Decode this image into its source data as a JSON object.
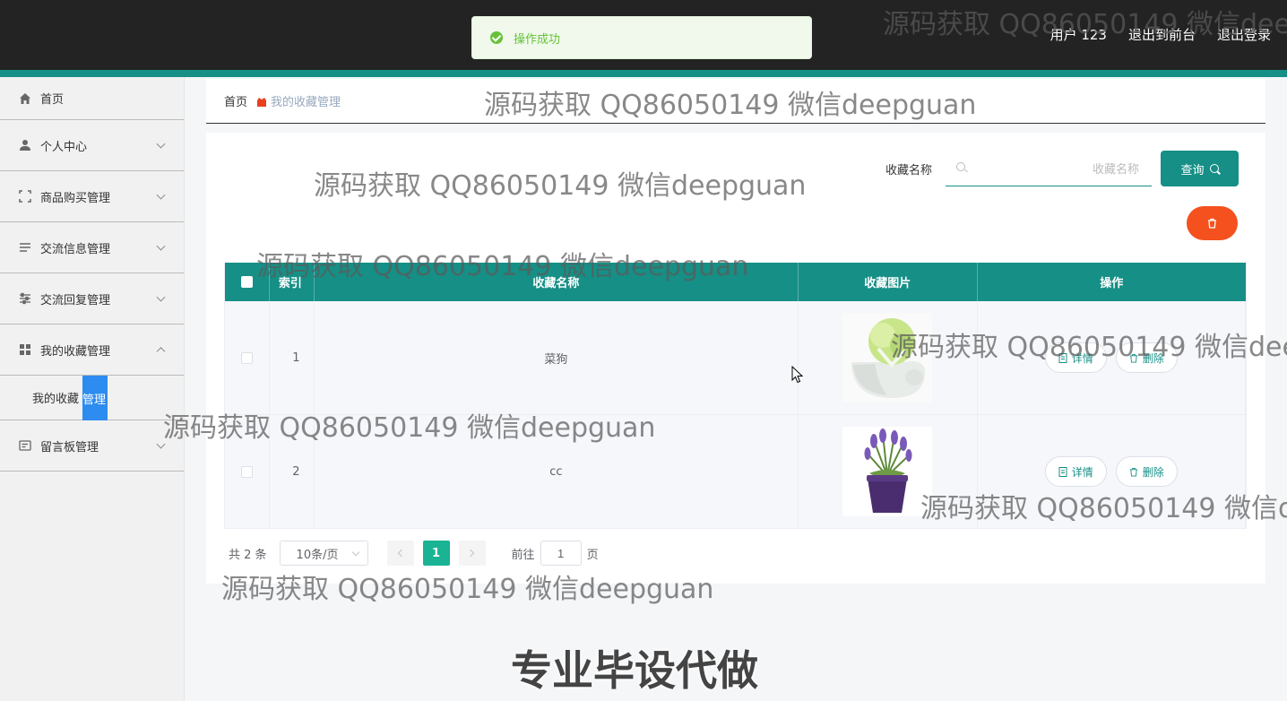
{
  "header": {
    "user_label": "用户 123",
    "back_to_front": "退出到前台",
    "logout": "退出登录",
    "toast": "操作成功"
  },
  "sidebar": {
    "items": [
      {
        "label": "首页",
        "icon": "home-icon"
      },
      {
        "label": "个人中心",
        "icon": "user-icon"
      },
      {
        "label": "商品购买管理",
        "icon": "scan-icon"
      },
      {
        "label": "交流信息管理",
        "icon": "list-icon"
      },
      {
        "label": "交流回复管理",
        "icon": "sliders-icon"
      },
      {
        "label": "我的收藏管理",
        "icon": "grid-icon"
      },
      {
        "label": "留言板管理",
        "icon": "board-icon"
      }
    ],
    "submenu": {
      "label_pre": "我的收藏",
      "label_hl": "管理"
    }
  },
  "breadcrumb": {
    "home": "首页",
    "current": "我的收藏管理"
  },
  "search": {
    "label": "收藏名称",
    "placeholder": "收藏名称",
    "button": "查询"
  },
  "table": {
    "columns": [
      "索引",
      "收藏名称",
      "收藏图片",
      "操作"
    ],
    "rows": [
      {
        "index": "1",
        "name": "菜狗",
        "image": "cabbage-dog-image"
      },
      {
        "index": "2",
        "name": "cc",
        "image": "lavender-pot-image"
      }
    ],
    "detail_label": "详情",
    "delete_label": "删除"
  },
  "pagination": {
    "total": "共 2 条",
    "page_size": "10条/页",
    "current_page": "1",
    "goto_pre": "前往",
    "goto_value": "1",
    "goto_post": "页"
  },
  "watermark": "源码获取 QQ86050149 微信deepguan",
  "banner": "专业毕设代做",
  "colors": {
    "accent": "#168f86",
    "danger": "#f4511e",
    "toast_green": "#67c23a",
    "page_active": "#1ab394"
  }
}
